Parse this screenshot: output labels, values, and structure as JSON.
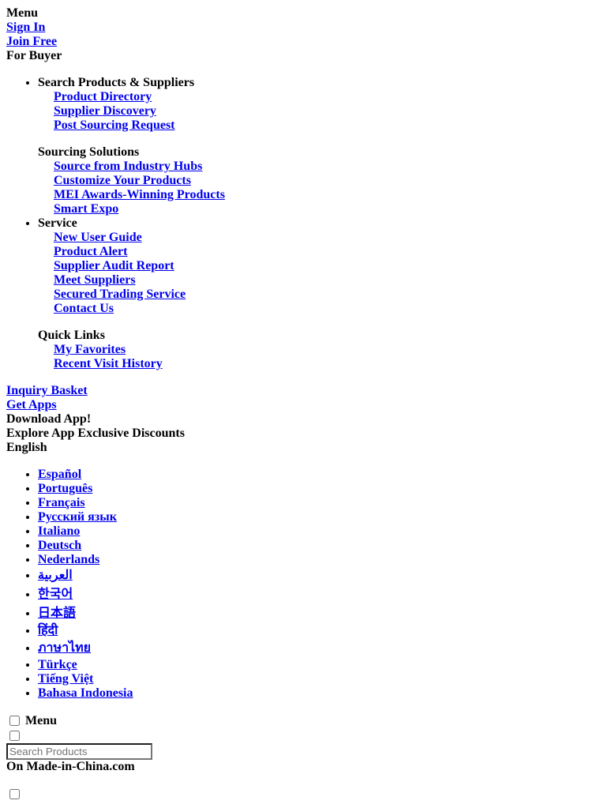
{
  "header": {
    "menu_label": "Menu",
    "sign_in": "Sign In",
    "join_free": "Join Free",
    "for_buyer": "For Buyer"
  },
  "nav": {
    "groups": [
      {
        "title": "Search Products & Suppliers",
        "links": [
          "Product Directory",
          "Supplier Discovery",
          "Post Sourcing Request"
        ],
        "subgroup": {
          "title": "Sourcing Solutions",
          "links": [
            "Source from Industry Hubs",
            "Customize Your Products",
            "MEI Awards-Winning Products",
            "Smart Expo"
          ]
        }
      },
      {
        "title": "Service",
        "links": [
          "New User Guide",
          "Product Alert",
          "Supplier Audit Report",
          "Meet Suppliers",
          "Secured Trading Service",
          "Contact Us"
        ],
        "subgroup": {
          "title": "Quick Links",
          "links": [
            "My Favorites",
            "Recent Visit History"
          ]
        }
      }
    ]
  },
  "utility": {
    "inquiry_basket": "Inquiry Basket",
    "get_apps": "Get Apps",
    "download_app": "Download App!",
    "explore_discounts": "Explore App Exclusive Discounts",
    "current_language": "English"
  },
  "languages": [
    "Español",
    "Português",
    "Français",
    "Русский язык",
    "Italiano",
    "Deutsch",
    "Nederlands",
    "العربية",
    "한국어",
    "日本語",
    "हिंदी",
    "ภาษาไทย",
    "Türkçe",
    "Tiếng Việt",
    "Bahasa Indonesia"
  ],
  "mobile_bar": {
    "menu_label": "Menu",
    "search_placeholder": "Search Products",
    "search_value": "",
    "on_site_label": "On Made-in-China.com"
  },
  "colors": {
    "link": "#0000EE",
    "link_visited": "#551A8B",
    "text": "#000000",
    "background": "#FFFFFF",
    "input_border": "#767676"
  }
}
